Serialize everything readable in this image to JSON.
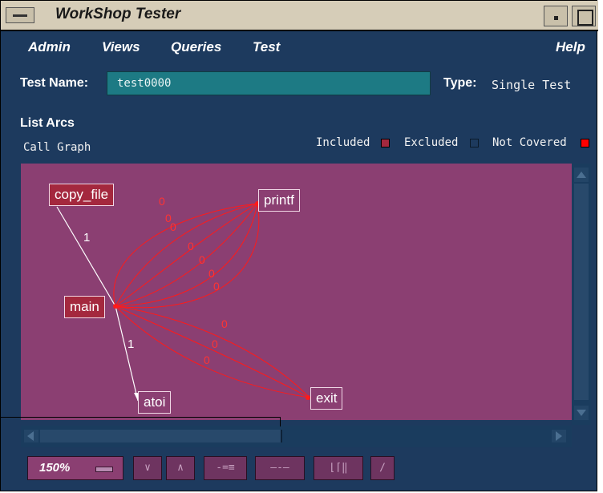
{
  "window": {
    "title": "WorkShop Tester"
  },
  "menubar": {
    "admin": "Admin",
    "views": "Views",
    "queries": "Queries",
    "test": "Test",
    "help": "Help"
  },
  "test": {
    "name_label": "Test Name:",
    "name_value": "test0000",
    "type_label": "Type:",
    "type_value": "Single Test"
  },
  "section": {
    "title": "List Arcs",
    "subtitle": "Call Graph"
  },
  "legend": {
    "included": "Included",
    "excluded": "Excluded",
    "not_covered": "Not Covered",
    "colors": {
      "included": "#a4283e",
      "excluded": "#1d3a5e",
      "not_covered": "#ff0000"
    }
  },
  "graph": {
    "nodes": {
      "copy_file": "copy_file",
      "printf": "printf",
      "main": "main",
      "atoi": "atoi",
      "exit": "exit"
    },
    "edge_labels": {
      "copy_file_main": "1",
      "main_atoi": "1",
      "zero": "0"
    },
    "colors": {
      "covered_arc": "#ffffff",
      "uncovered_arc": "#ff1a1a"
    }
  },
  "toolbar": {
    "zoom": "150%"
  }
}
